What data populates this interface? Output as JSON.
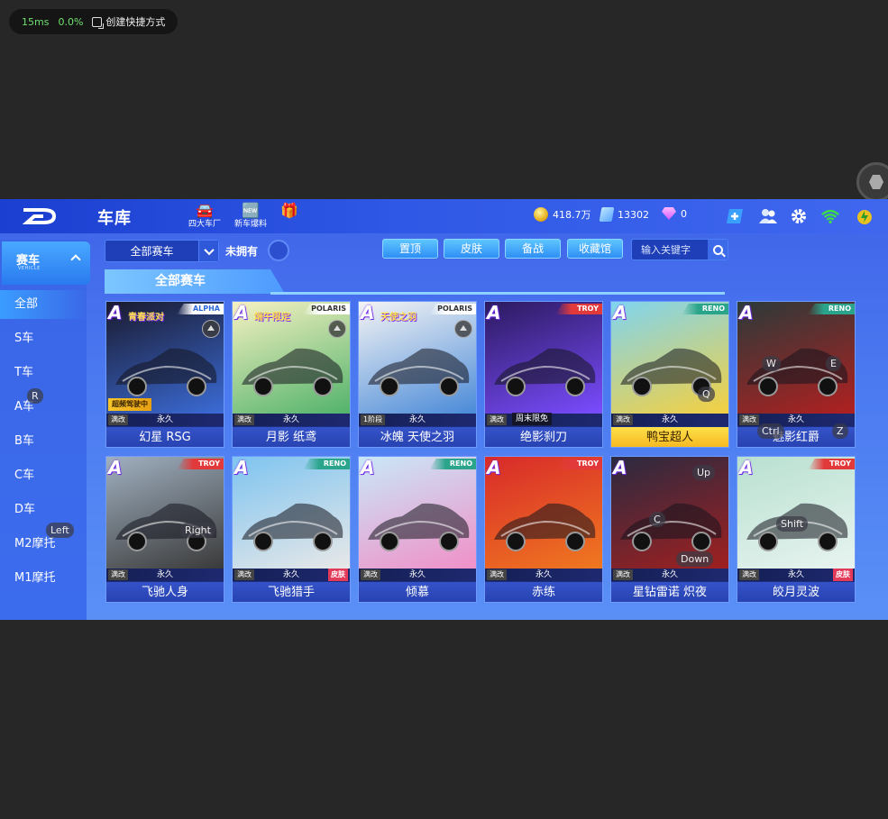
{
  "overlay": {
    "latency": "15ms",
    "cpu": "0.0%",
    "shortcut_label": "创建快捷方式"
  },
  "header": {
    "title": "车库",
    "icons": [
      {
        "label": "四大车厂",
        "glyph": "🚘"
      },
      {
        "label": "新车爆料",
        "glyph": "🆕"
      },
      {
        "label": "",
        "glyph": "🎁"
      }
    ],
    "coins": "418.7万",
    "cards": "13302",
    "gems": "0"
  },
  "sidebar": {
    "header": {
      "label": "赛车",
      "sub": "VEHICLE"
    },
    "items": [
      {
        "label": "全部",
        "active": true
      },
      {
        "label": "S车"
      },
      {
        "label": "T车"
      },
      {
        "label": "A车"
      },
      {
        "label": "B车"
      },
      {
        "label": "C车"
      },
      {
        "label": "D车"
      },
      {
        "label": "M2摩托"
      },
      {
        "label": "M1摩托"
      }
    ]
  },
  "filters": {
    "dropdown_value": "全部赛车",
    "not_owned_label": "未拥有",
    "buttons": [
      "置顶",
      "皮肤",
      "备战",
      "收藏馆"
    ],
    "search_placeholder": "输入关键字"
  },
  "section_title": "全部赛车",
  "cars": [
    {
      "rank": "A",
      "brand": "ALPHA",
      "brand_class": "alpha",
      "art_text": "青春派对",
      "tag": "满改",
      "perm": "永久",
      "badge": "超频驾驶中",
      "name": "幻星 RSG",
      "eject": true,
      "c1": "#1a1a2e",
      "c2": "#3b6bd6"
    },
    {
      "rank": "A",
      "brand": "POLARIS",
      "brand_class": "polaris",
      "art_text": "端午限定",
      "tag": "满改",
      "perm": "永久",
      "name": "月影 纸鸢",
      "eject": true,
      "c1": "#f6f1c2",
      "c2": "#52b36b"
    },
    {
      "rank": "A",
      "brand": "POLARIS",
      "brand_class": "polaris",
      "art_text": "天使之羽",
      "tag": "1阶段",
      "perm": "永久",
      "name": "冰魄 天使之羽",
      "eject": true,
      "c1": "#f4f4f4",
      "c2": "#4a8ad8"
    },
    {
      "rank": "A",
      "brand": "TROY",
      "brand_class": "troy",
      "tag": "满改",
      "promo": "周末限免",
      "name": "绝影刹刀",
      "c1": "#2b1a5e",
      "c2": "#7a4cff"
    },
    {
      "rank": "A",
      "brand": "RENO",
      "brand_class": "reno",
      "tag": "满改",
      "perm": "永久",
      "name": "鸭宝超人",
      "gold": true,
      "c1": "#7fd4f0",
      "c2": "#f4d040"
    },
    {
      "rank": "A",
      "brand": "RENO",
      "brand_class": "reno",
      "tag": "满改",
      "perm": "永久",
      "name": "魅影红爵",
      "c1": "#2b3a3a",
      "c2": "#b02020"
    },
    {
      "rank": "A",
      "brand": "TROY",
      "brand_class": "troy",
      "tag": "满改",
      "perm": "永久",
      "name": "飞驰人身",
      "c1": "#a0b0c0",
      "c2": "#3a3a3a"
    },
    {
      "rank": "A",
      "brand": "RENO",
      "brand_class": "reno",
      "tag": "满改",
      "perm": "永久",
      "skin": "皮肤",
      "name": "飞驰猎手",
      "c1": "#7ec4f0",
      "c2": "#e8e8e8"
    },
    {
      "rank": "A",
      "brand": "RENO",
      "brand_class": "reno",
      "tag": "满改",
      "perm": "永久",
      "name": "倾慕",
      "c1": "#c8e8f8",
      "c2": "#f090c8"
    },
    {
      "rank": "A",
      "brand": "TROY",
      "brand_class": "troy",
      "tag": "满改",
      "perm": "永久",
      "name": "赤练",
      "c1": "#d82a2a",
      "c2": "#f07820"
    },
    {
      "rank": "A",
      "brand": "",
      "brand_class": "",
      "tag": "满改",
      "perm": "永久",
      "name": "星钻雷诺 炽夜",
      "c1": "#2a2a40",
      "c2": "#a02020"
    },
    {
      "rank": "A",
      "brand": "TROY",
      "brand_class": "troy",
      "tag": "满改",
      "perm": "永久",
      "skin": "皮肤",
      "name": "皎月灵波",
      "c1": "#b8e0d0",
      "c2": "#e8f4f0"
    }
  ],
  "keys": [
    "R",
    "Left",
    "Right",
    "W",
    "E",
    "Q",
    "Ctrl",
    "Z",
    "Up",
    "C",
    "Down",
    "Shift"
  ]
}
